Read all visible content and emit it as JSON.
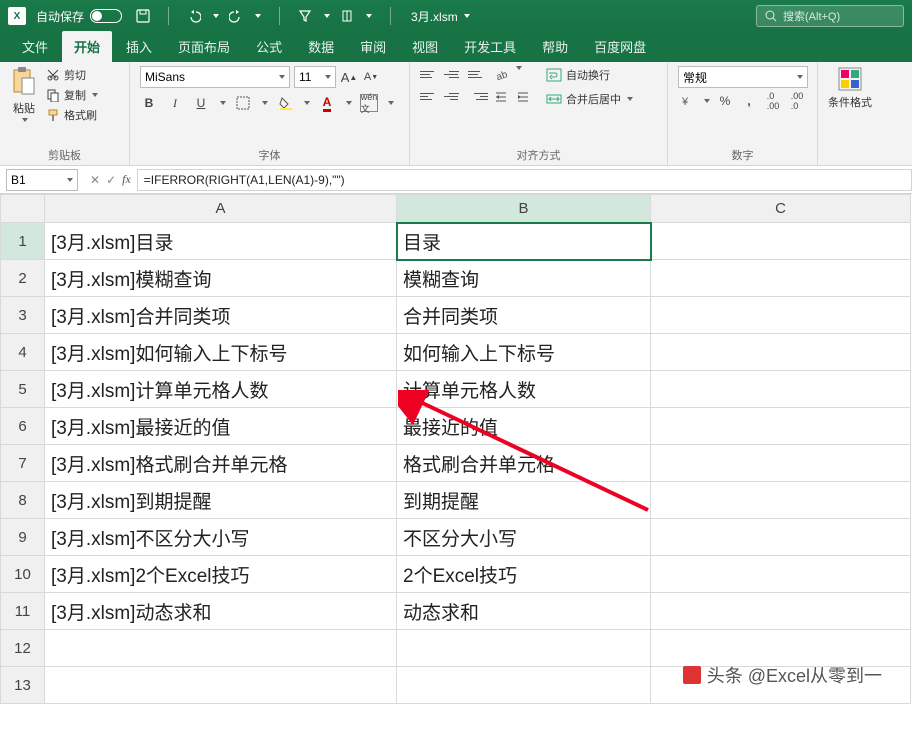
{
  "titlebar": {
    "autosave_label": "自动保存",
    "filename": "3月.xlsm",
    "search_placeholder": "搜索(Alt+Q)"
  },
  "tabs": {
    "file": "文件",
    "home": "开始",
    "insert": "插入",
    "layout": "页面布局",
    "formulas": "公式",
    "data": "数据",
    "review": "审阅",
    "view": "视图",
    "dev": "开发工具",
    "help": "帮助",
    "baidu": "百度网盘"
  },
  "ribbon": {
    "paste": "粘贴",
    "cut": "剪切",
    "copy": "复制",
    "formatpainter": "格式刷",
    "clipboard_group": "剪贴板",
    "font_name": "MiSans",
    "font_size": "11",
    "font_group": "字体",
    "wrap": "自动换行",
    "merge": "合并后居中",
    "align_group": "对齐方式",
    "number_format": "常规",
    "number_group": "数字",
    "condfmt": "条件格式"
  },
  "fx": {
    "namebox": "B1",
    "formula": "=IFERROR(RIGHT(A1,LEN(A1)-9),\"\")"
  },
  "columns": [
    "A",
    "B",
    "C"
  ],
  "rows": [
    {
      "n": "1",
      "A": "[3月.xlsm]目录",
      "B": "目录",
      "C": ""
    },
    {
      "n": "2",
      "A": "[3月.xlsm]模糊查询",
      "B": "模糊查询",
      "C": ""
    },
    {
      "n": "3",
      "A": "[3月.xlsm]合并同类项",
      "B": "合并同类项",
      "C": ""
    },
    {
      "n": "4",
      "A": "[3月.xlsm]如何输入上下标号",
      "B": "如何输入上下标号",
      "C": ""
    },
    {
      "n": "5",
      "A": "[3月.xlsm]计算单元格人数",
      "B": "计算单元格人数",
      "C": ""
    },
    {
      "n": "6",
      "A": "[3月.xlsm]最接近的值",
      "B": "最接近的值",
      "C": ""
    },
    {
      "n": "7",
      "A": "[3月.xlsm]格式刷合并单元格",
      "B": "格式刷合并单元格",
      "C": ""
    },
    {
      "n": "8",
      "A": "[3月.xlsm]到期提醒",
      "B": "到期提醒",
      "C": ""
    },
    {
      "n": "9",
      "A": "[3月.xlsm]不区分大小写",
      "B": "不区分大小写",
      "C": ""
    },
    {
      "n": "10",
      "A": "[3月.xlsm]2个Excel技巧",
      "B": "2个Excel技巧",
      "C": ""
    },
    {
      "n": "11",
      "A": "[3月.xlsm]动态求和",
      "B": "动态求和",
      "C": ""
    },
    {
      "n": "12",
      "A": "",
      "B": "",
      "C": ""
    },
    {
      "n": "13",
      "A": "",
      "B": "",
      "C": ""
    }
  ],
  "watermark": "头条 @Excel从零到一"
}
